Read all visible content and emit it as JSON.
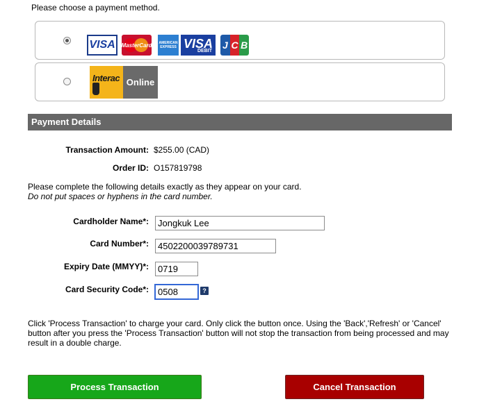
{
  "intro": "Please choose a payment method.",
  "payment_methods": {
    "cards": {
      "selected": true,
      "logos": [
        "VISA",
        "MasterCard",
        "AMERICAN EXPRESS",
        "VISA DEBIT",
        "JCB"
      ],
      "amex_text": "AMERICAN EXPRESS",
      "visa_debit_visa": "VISA",
      "visa_debit_debit": "DEBIT",
      "jcb": [
        "J",
        "C",
        "B"
      ]
    },
    "interac": {
      "selected": false,
      "brand": "Interac",
      "label": "Online"
    }
  },
  "details": {
    "header": "Payment Details",
    "amount_label": "Transaction Amount:",
    "amount_value": "$255.00 (CAD)",
    "order_label": "Order ID:",
    "order_value": "O157819798",
    "instruction_line1": "Please complete the following details exactly as they appear on your card.",
    "instruction_line2": "Do not put spaces or hyphens in the card number."
  },
  "form": {
    "cardholder_label": "Cardholder Name*:",
    "cardholder_value": "Jongkuk Lee",
    "card_number_label": "Card Number*:",
    "card_number_value": "4502200039789731",
    "expiry_label": "Expiry Date (MMYY)*:",
    "expiry_value": "0719",
    "cvc_label": "Card Security Code*:",
    "cvc_value": "0508",
    "help_icon": "question-mark-icon",
    "help_glyph": "?"
  },
  "notice": "Click 'Process Transaction' to charge your card. Only click the button once. Using the 'Back','Refresh' or 'Cancel' button after you press the 'Process Transaction' button will not stop the transaction from being processed and may result in a double charge.",
  "buttons": {
    "process": "Process Transaction",
    "cancel": "Cancel Transaction"
  },
  "colors": {
    "header_bg": "#676767",
    "process_bg": "#17a71a",
    "cancel_bg": "#a80000"
  }
}
